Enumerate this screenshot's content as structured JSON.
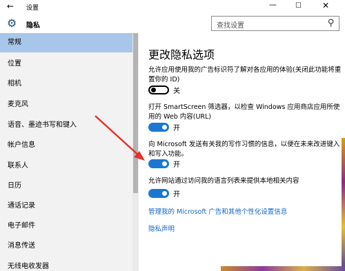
{
  "window": {
    "title": "设置",
    "back_icon": "←",
    "minimize_icon": "—",
    "maximize_icon": "☐",
    "close_icon": "✕"
  },
  "header": {
    "gear_icon": "⚙",
    "title": "隐私",
    "search_placeholder": "查找设置",
    "search_icon": "⚲"
  },
  "sidebar": {
    "items": [
      {
        "label": "常规",
        "active": true
      },
      {
        "label": "位置"
      },
      {
        "label": "相机"
      },
      {
        "label": "麦克风"
      },
      {
        "label": "语音、墨迹书写和键入"
      },
      {
        "label": "帐户信息"
      },
      {
        "label": "联系人"
      },
      {
        "label": "日历"
      },
      {
        "label": "通话记录"
      },
      {
        "label": "电子邮件"
      },
      {
        "label": "消息传送"
      },
      {
        "label": "无线电收发器"
      }
    ]
  },
  "main": {
    "title": "更改隐私选项",
    "settings": [
      {
        "description": "允许应用使用我的广告标识符了解对各应用的体验(关闭此功能将重置你的 ID)",
        "state": "关",
        "on": false
      },
      {
        "description": "打开 SmartScreen 筛选器，以检查 Windows 应用商店应用所使用的 Web 内容(URL)",
        "state": "开",
        "on": true
      },
      {
        "description": "向 Microsoft 发送有关我的写作习惯的信息，以便在未来改进键入和写入功能。",
        "state": "开",
        "on": true
      },
      {
        "description": "允许网站通过访问我的语言列表来提供本地相关内容",
        "state": "开",
        "on": true
      }
    ],
    "links": {
      "manage": "管理我的 Microsoft 广告和其他个性化设置信息",
      "privacy": "隐私声明"
    }
  },
  "colors": {
    "accent": "#1b77d2",
    "sidebar_active": "#a7c6e9",
    "arrow": "#e8302a"
  }
}
